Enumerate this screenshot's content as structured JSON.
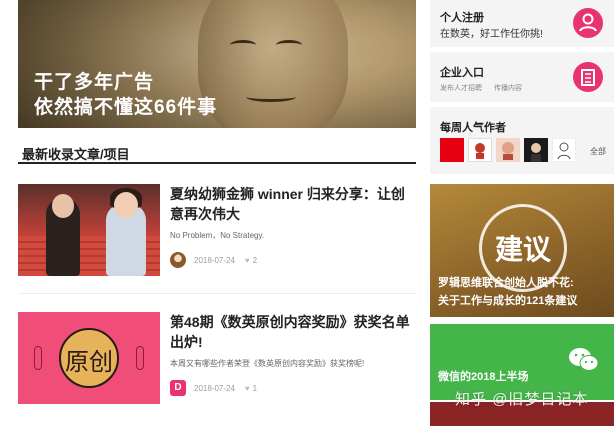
{
  "hero": {
    "line1": "干了多年广告",
    "line2": "依然搞不懂这66件事"
  },
  "section": {
    "title": "最新收录文章/项目"
  },
  "articles": [
    {
      "title": "夏纳幼狮金狮 winner 归来分享：让创意再次伟大",
      "desc": "No Problem，No Strategy.",
      "date": "2018-07-24",
      "likes": "2"
    },
    {
      "title": "第48期《数英原创内容奖励》获奖名单出炉!",
      "desc": "本周又有哪些作者荣登《数英原创内容奖励》获奖榜呢!",
      "date": "2018-07-24",
      "likes": "1",
      "thumb_text": "原创",
      "avatar_letter": "D"
    }
  ],
  "sidebar": {
    "register": {
      "title": "个人注册",
      "subtitle": "在数英，好工作任你挑!"
    },
    "company": {
      "title": "企业入口",
      "sub1": "发布人才招聘",
      "sub2": "传播内容"
    },
    "weekly": {
      "title": "每周人气作者",
      "more": "全部",
      "avatar_colors": [
        "#e60012",
        "#ffffff",
        "#f3d6c8",
        "#1a1a1a",
        "#ffffff"
      ]
    },
    "advice": {
      "word": "建议",
      "line1": "罗辑思维联合创始人脱不花:",
      "line2": "关于工作与成长的121条建议"
    },
    "wechat": {
      "text": "微信的2018上半场"
    }
  },
  "watermark": "知乎 @旧梦日记本",
  "colors": {
    "accent": "#e8336e",
    "wechat_green": "#44b549"
  }
}
